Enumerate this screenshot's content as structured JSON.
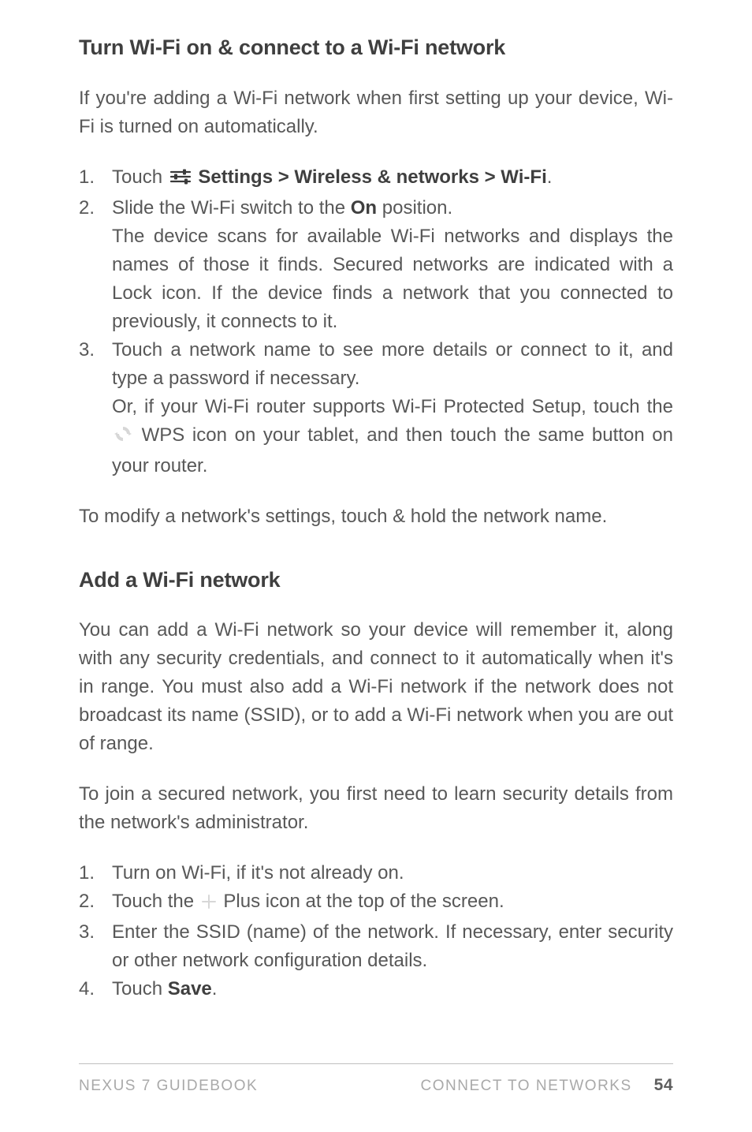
{
  "section1": {
    "heading": "Turn Wi-Fi on & connect to a Wi-Fi network",
    "intro": "If you're adding a Wi-Fi network when first setting up your device, Wi-Fi is turned on automatically.",
    "steps": {
      "s1_a": "Touch ",
      "s1_b": " Settings > Wireless & networks > Wi-Fi",
      "s1_c": ".",
      "s2_a": "Slide the Wi-Fi switch to the ",
      "s2_b": "On",
      "s2_c": " position.",
      "s2_detail": "The device scans for available Wi-Fi networks and displays the names of those it finds. Secured networks are indicated with a Lock icon. If the device finds a network that you connected to previously, it connects to it.",
      "s3_a": "Touch a network name to see more details or connect to it, and type a password if necessary.",
      "s3_b1": "Or, if your Wi-Fi router supports Wi-Fi Protected Setup, touch the ",
      "s3_b2": " WPS icon on your tablet, and then touch the same button on your router."
    },
    "outro": "To modify a network's settings, touch & hold the network name."
  },
  "section2": {
    "heading": "Add a Wi-Fi network",
    "p1": "You can add a Wi-Fi network so your device will remember it, along with any security credentials, and connect to it automatically when it's in range. You must also add a Wi-Fi network if the network does not broadcast its name (SSID), or to add a Wi-Fi network when you are out of range.",
    "p2": "To join a secured network, you first need to learn security details from the network's administrator.",
    "steps": {
      "s1": "Turn on Wi-Fi, if it's not already on.",
      "s2_a": "Touch the ",
      "s2_b": " Plus icon at the top of the screen.",
      "s3": "Enter the SSID (name) of the network. If necessary, enter security or other network configuration details.",
      "s4_a": "Touch ",
      "s4_b": "Save",
      "s4_c": "."
    }
  },
  "footer": {
    "left": "NEXUS 7 GUIDEBOOK",
    "right_label": "CONNECT TO NETWORKS",
    "page": "54"
  },
  "icons": {
    "settings": "settings-sliders-icon",
    "wps": "wps-rotate-icon",
    "plus": "plus-icon"
  }
}
